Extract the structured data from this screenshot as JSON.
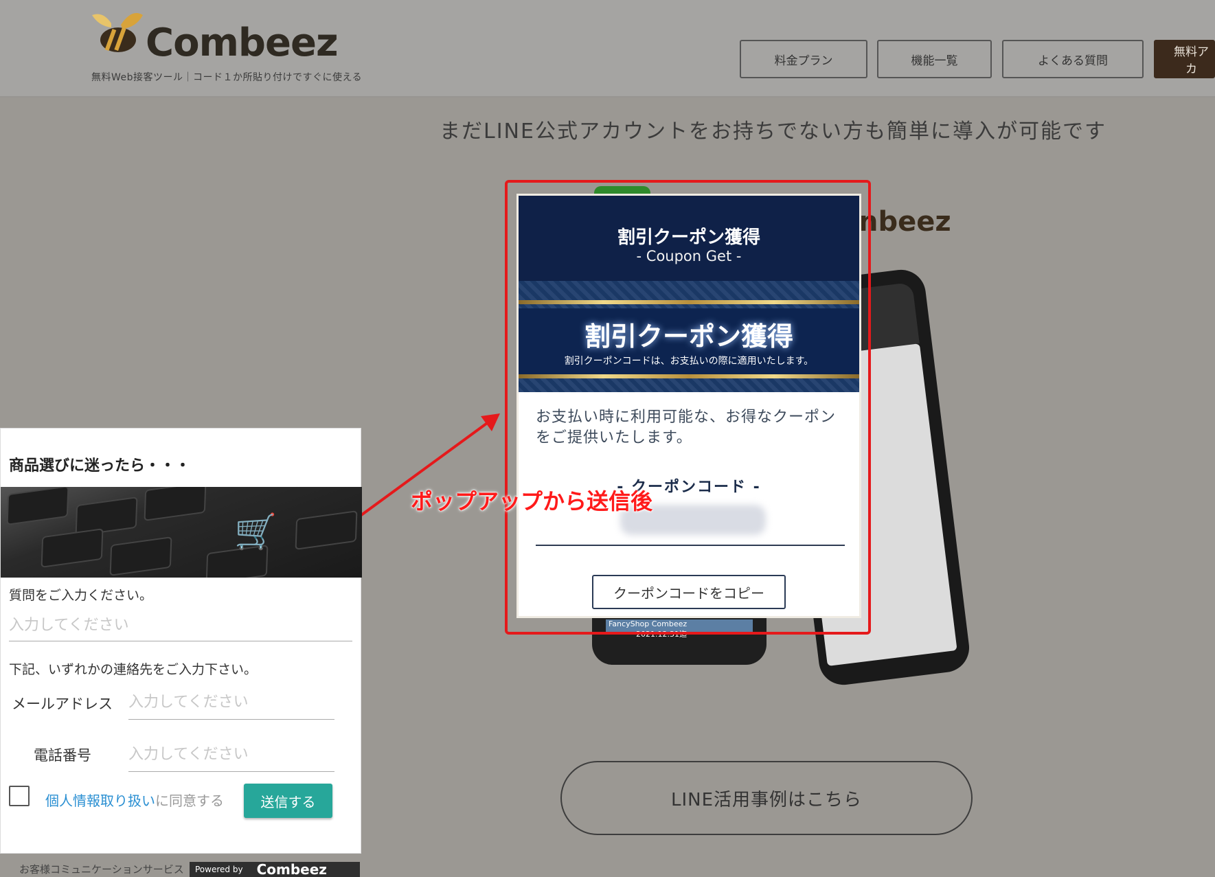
{
  "header": {
    "logo_text": "Combeez",
    "tagline": "無料Web接客ツール｜コード１か所貼り付けですぐに使える",
    "nav": [
      "料金プラン",
      "機能一覧",
      "よくある質問",
      "無料アカ"
    ]
  },
  "lead_text": "まだLINE公式アカウントをお持ちでない方も簡単に導入が可能です",
  "background": {
    "logo_fragment": "nbeez",
    "phone_bar": "FancyShop Combeez",
    "phone_date": "2021.12.31迄",
    "line_button": "LINE活用事例はこちら"
  },
  "popup": {
    "title": "割引クーポン獲得",
    "subtitle": "- Coupon Get -",
    "banner_title": "割引クーポン獲得",
    "banner_note": "割引クーポンコードは、お支払いの際に適用いたします。",
    "description": "お支払い時に利用可能な、お得なクーポンをご提供いたします。",
    "code_label": "- クーポンコード -",
    "copy_button": "クーポンコードをコピー"
  },
  "annotation": "ポップアップから送信後",
  "widget": {
    "title": "商品選びに迷ったら・・・",
    "question_label": "質問をご入力ください。",
    "placeholder": "入力してください",
    "contact_note": "下記、いずれかの連絡先をご入力下さい。",
    "email_label": "メールアドレス",
    "phone_label": "電話番号",
    "privacy_link": "個人情報取り扱い",
    "agree_text": "に同意する",
    "send_button": "送信する",
    "footer": "お客様コミュニケーションサービス",
    "powered_by": "Powered by",
    "powered_logo": "Combeez"
  },
  "colors": {
    "accent_red": "#e5191b",
    "navy": "#0f2148",
    "teal": "#27a79a"
  }
}
